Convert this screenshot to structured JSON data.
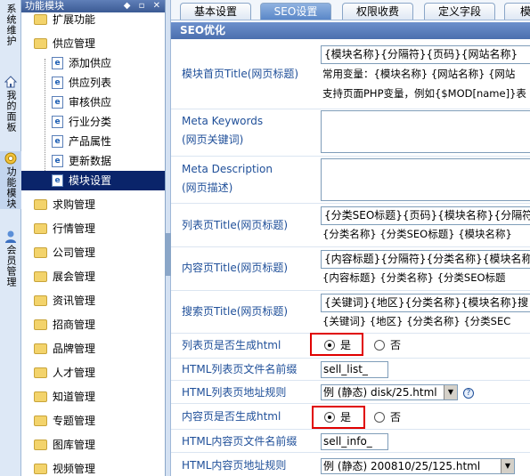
{
  "side_tabs": [
    {
      "label": "系统维护",
      "icon": "wrench-icon"
    },
    {
      "label": "我的面板",
      "icon": "home-icon"
    },
    {
      "label": "功能模块",
      "icon": "gear-icon"
    },
    {
      "label": "会员管理",
      "icon": "user-icon"
    }
  ],
  "tree": {
    "title": "功能模块",
    "items": [
      {
        "label": "扩展功能",
        "type": "folder",
        "level": 0
      },
      {
        "label": "供应管理",
        "type": "folder",
        "level": 0
      },
      {
        "label": "添加供应",
        "type": "page",
        "level": 1
      },
      {
        "label": "供应列表",
        "type": "page",
        "level": 1
      },
      {
        "label": "审核供应",
        "type": "page",
        "level": 1
      },
      {
        "label": "行业分类",
        "type": "page",
        "level": 1
      },
      {
        "label": "产品属性",
        "type": "page",
        "level": 1
      },
      {
        "label": "更新数据",
        "type": "page",
        "level": 1
      },
      {
        "label": "模块设置",
        "type": "page",
        "level": 1,
        "selected": true
      },
      {
        "label": "求购管理",
        "type": "folder",
        "level": 0
      },
      {
        "label": "行情管理",
        "type": "folder",
        "level": 0
      },
      {
        "label": "公司管理",
        "type": "folder",
        "level": 0
      },
      {
        "label": "展会管理",
        "type": "folder",
        "level": 0
      },
      {
        "label": "资讯管理",
        "type": "folder",
        "level": 0
      },
      {
        "label": "招商管理",
        "type": "folder",
        "level": 0
      },
      {
        "label": "品牌管理",
        "type": "folder",
        "level": 0
      },
      {
        "label": "人才管理",
        "type": "folder",
        "level": 0
      },
      {
        "label": "知道管理",
        "type": "folder",
        "level": 0
      },
      {
        "label": "专题管理",
        "type": "folder",
        "level": 0
      },
      {
        "label": "图库管理",
        "type": "folder",
        "level": 0
      },
      {
        "label": "视频管理",
        "type": "folder",
        "level": 0
      }
    ]
  },
  "tabs": [
    "基本设置",
    "SEO设置",
    "权限收费",
    "定义字段",
    "模板"
  ],
  "active_tab": 1,
  "section_title": "SEO优化",
  "form": {
    "home_title_label": "模块首页Title(网页标题)",
    "home_title_value": "{模块名称}{分隔符}{页码}{网站名称}",
    "home_title_hint1": "常用变量：{模块名称}  {网站名称}  {网站",
    "home_title_hint2": "支持页面PHP变量，例如{$MOD[name]}表",
    "meta_keywords_label1": "Meta Keywords",
    "meta_keywords_label2": "(网页关键词)",
    "meta_desc_label1": "Meta Description",
    "meta_desc_label2": "(网页描述)",
    "list_title_label": "列表页Title(网页标题)",
    "list_title_value": "{分类SEO标题}{页码}{模块名称}{分隔符",
    "list_title_hint": "{分类名称}  {分类SEO标题}  {模块名称}",
    "content_title_label": "内容页Title(网页标题)",
    "content_title_value": "{内容标题}{分隔符}{分类名称}{模块名称",
    "content_title_hint": "{内容标题}  {分类名称}  {分类SEO标题",
    "search_title_label": "搜索页Title(网页标题)",
    "search_title_value": "{关键词}{地区}{分类名称}{模块名称}搜",
    "search_title_hint": "{关键词}  {地区}  {分类名称}  {分类SEC",
    "list_html_label": "列表页是否生成html",
    "yes": "是",
    "no": "否",
    "list_prefix_label": "HTML列表页文件名前缀",
    "list_prefix_value": "sell_list_",
    "list_rule_label": "HTML列表页地址规则",
    "list_rule_value": "例 (静态) disk/25.html",
    "content_html_label": "内容页是否生成html",
    "content_prefix_label": "HTML内容页文件名前缀",
    "content_prefix_value": "sell_info_",
    "content_rule_label": "HTML内容页地址规则",
    "content_rule_value": "例 (静态) 200810/25/125.html",
    "help_glyph": "?"
  },
  "colors": {
    "accent_red": "#e00000",
    "header_blue": "#4b6fae",
    "label_blue": "#1f4f99",
    "selection": "#0a246a"
  }
}
